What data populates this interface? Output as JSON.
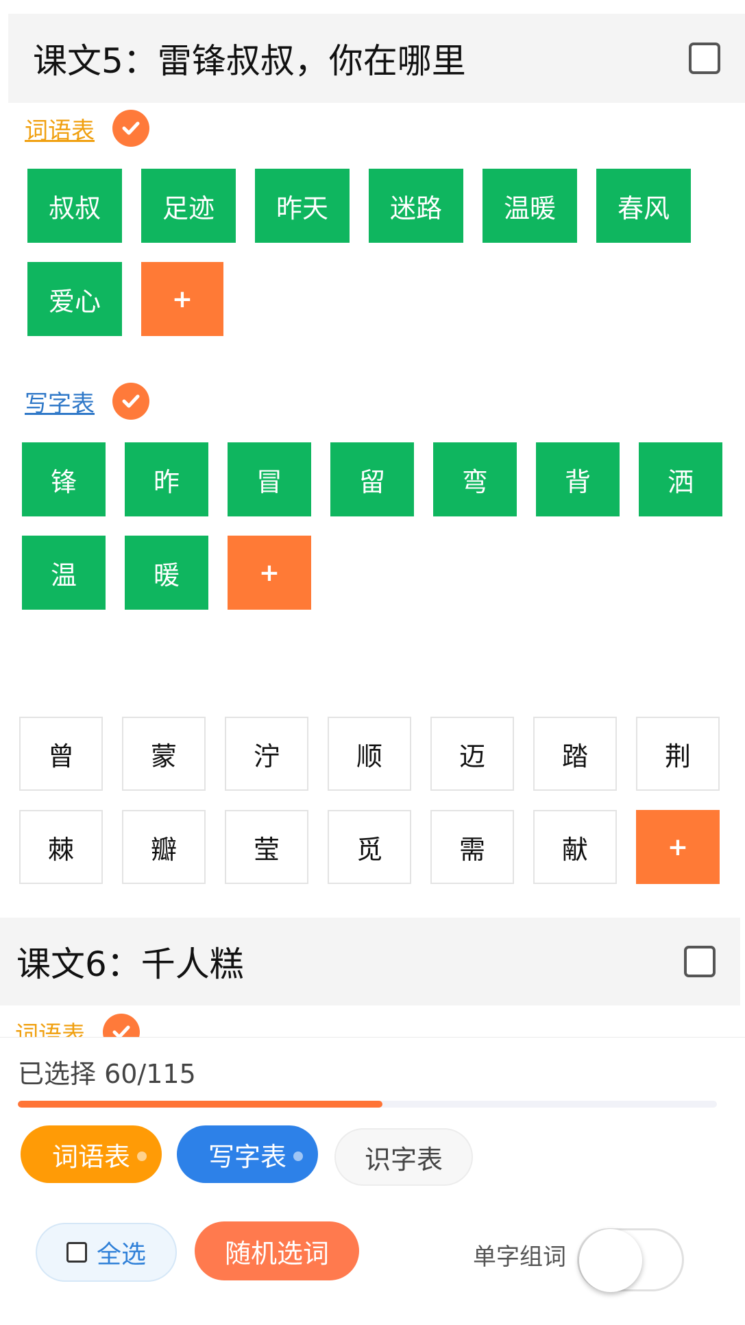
{
  "lesson5": {
    "title": "课文5：雷锋叔叔，你在哪里",
    "word_table": {
      "label": "词语表",
      "words": [
        "叔叔",
        "足迹",
        "昨天",
        "迷路",
        "温暖",
        "春风",
        "爱心"
      ],
      "add_label": "+"
    },
    "writing_table": {
      "label": "写字表",
      "chars": [
        "锋",
        "昨",
        "冒",
        "留",
        "弯",
        "背",
        "洒",
        "温",
        "暖"
      ],
      "add_label": "+"
    },
    "recognition_chars": [
      "曾",
      "蒙",
      "泞",
      "顺",
      "迈",
      "踏",
      "荆",
      "棘",
      "瓣",
      "莹",
      "觅",
      "需",
      "献"
    ],
    "recognition_add_label": "+"
  },
  "lesson6": {
    "title": "课文6：千人糕",
    "word_table_label": "词语表"
  },
  "bottom": {
    "selected_text": "已选择 60/115",
    "progress": 0.522,
    "filters": [
      "词语表",
      "写字表",
      "识字表"
    ],
    "select_all_label": "全选",
    "random_label": "随机选词",
    "toggle_label": "单字组词",
    "toggle_on": false
  },
  "colors": {
    "green_tile": "#0fb65f",
    "orange_tile": "#ff7a36",
    "word_link": "#f0a010",
    "writing_link": "#2f78c8",
    "progress": "#ff7436"
  }
}
